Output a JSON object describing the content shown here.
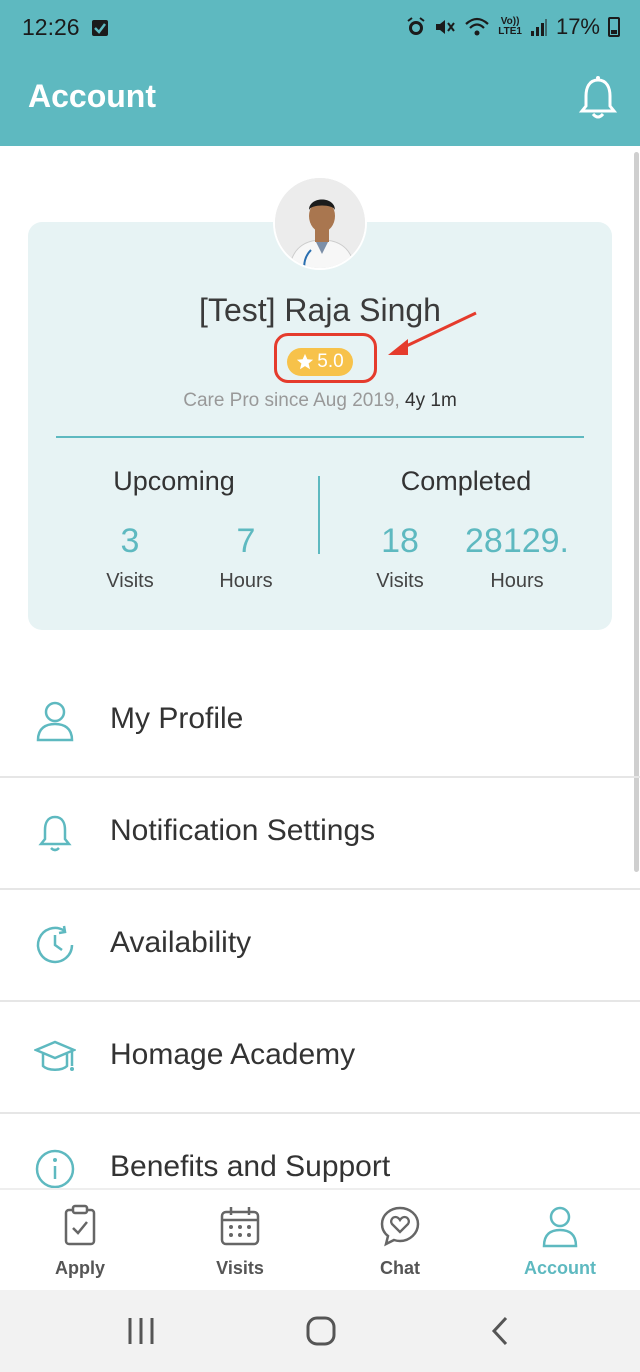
{
  "status_bar": {
    "time": "12:26",
    "network_top": "Vo))",
    "network_bottom": "LTE1",
    "battery": "17%"
  },
  "header": {
    "title": "Account"
  },
  "profile": {
    "name": "[Test] Raja Singh",
    "rating": "5.0",
    "since_text": "Care Pro since Aug 2019,",
    "duration": "4y 1m"
  },
  "stats": {
    "upcoming": {
      "heading": "Upcoming",
      "visits_value": "3",
      "visits_label": "Visits",
      "hours_value": "7",
      "hours_label": "Hours"
    },
    "completed": {
      "heading": "Completed",
      "visits_value": "18",
      "visits_label": "Visits",
      "hours_value": "28129.",
      "hours_label": "Hours"
    }
  },
  "menu": [
    {
      "label": "My Profile",
      "icon": "person-icon"
    },
    {
      "label": "Notification Settings",
      "icon": "bell-icon"
    },
    {
      "label": "Availability",
      "icon": "clock-icon"
    },
    {
      "label": "Homage Academy",
      "icon": "graduation-cap-icon"
    },
    {
      "label": "Benefits and Support",
      "icon": "info-icon"
    }
  ],
  "bottom_nav": [
    {
      "label": "Apply",
      "icon": "clipboard-check-icon"
    },
    {
      "label": "Visits",
      "icon": "calendar-icon"
    },
    {
      "label": "Chat",
      "icon": "chat-heart-icon"
    },
    {
      "label": "Account",
      "icon": "person-icon",
      "active": true
    }
  ],
  "colors": {
    "accent": "#5eb9c0",
    "rating_badge": "#f7c24a",
    "annotation_red": "#e53b2c",
    "card_bg": "#e7f3f4"
  }
}
